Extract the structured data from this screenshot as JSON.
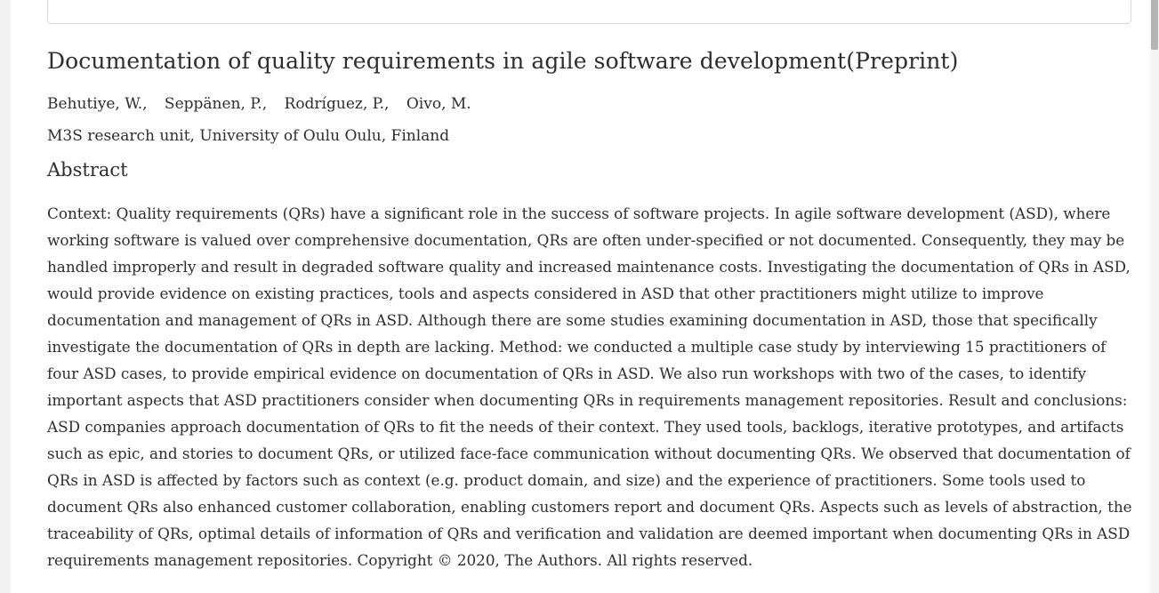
{
  "paper": {
    "title": "Documentation of quality requirements in agile software development(Preprint)",
    "authors": [
      "Behutiye, W.,",
      "Seppänen, P.,",
      "Rodríguez, P.,",
      "Oivo, M."
    ],
    "affiliation": "M3S research unit, University of Oulu Oulu, Finland",
    "abstract_heading": "Abstract",
    "abstract_text": "Context: Quality requirements (QRs) have a significant role in the success of software projects. In agile software development (ASD), where working software is valued over comprehensive documentation, QRs are often under-specified or not documented. Consequently, they may be handled improperly and result in degraded software quality and increased maintenance costs. Investigating the documentation of QRs in ASD, would provide evidence on existing practices, tools and aspects considered in ASD that other practitioners might utilize to improve documentation and management of QRs in ASD. Although there are some studies examining documentation in ASD, those that specifically investigate the documentation of QRs in depth are lacking. Method: we conducted a multiple case study by interviewing 15 practitioners of four ASD cases, to provide empirical evidence on documentation of QRs in ASD. We also run workshops with two of the cases, to identify important aspects that ASD practitioners consider when documenting QRs in requirements management repositories. Result and conclusions: ASD companies approach documentation of QRs to fit the needs of their context. They used tools, backlogs, iterative prototypes, and artifacts such as epic, and stories to document QRs, or utilized face-face communication without documenting QRs. We observed that documentation of QRs in ASD is affected by factors such as context (e.g. product domain, and size) and the experience of practitioners. Some tools used to document QRs also enhanced customer collaboration, enabling customers report and document QRs. Aspects such as levels of abstraction, the traceability of QRs, optimal details of information of QRs and verification and validation are deemed important when documenting QRs in ASD requirements management repositories. Copyright © 2020, The Authors. All rights reserved."
  }
}
